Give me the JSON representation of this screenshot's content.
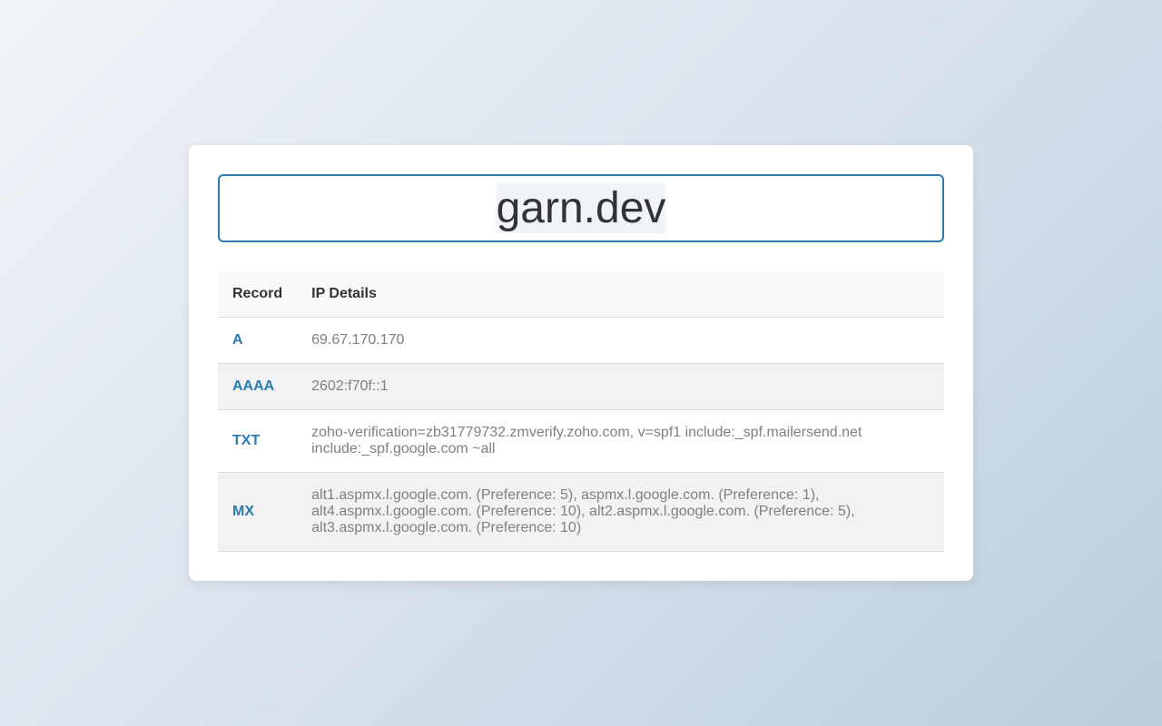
{
  "domain": "garn.dev",
  "table": {
    "headers": {
      "record": "Record",
      "details": "IP Details"
    },
    "rows": [
      {
        "type": "A",
        "value": "69.67.170.170"
      },
      {
        "type": "AAAA",
        "value": "2602:f70f::1"
      },
      {
        "type": "TXT",
        "value": "zoho-verification=zb31779732.zmverify.zoho.com, v=spf1 include:_spf.mailersend.net include:_spf.google.com ~all"
      },
      {
        "type": "MX",
        "value": "alt1.aspmx.l.google.com. (Preference: 5), aspmx.l.google.com. (Preference: 1), alt4.aspmx.l.google.com. (Preference: 10), alt2.aspmx.l.google.com. (Preference: 5), alt3.aspmx.l.google.com. (Preference: 10)"
      }
    ]
  },
  "colors": {
    "accent": "#2b7bb0",
    "muted_text": "#808080",
    "heading_text": "#333333"
  }
}
